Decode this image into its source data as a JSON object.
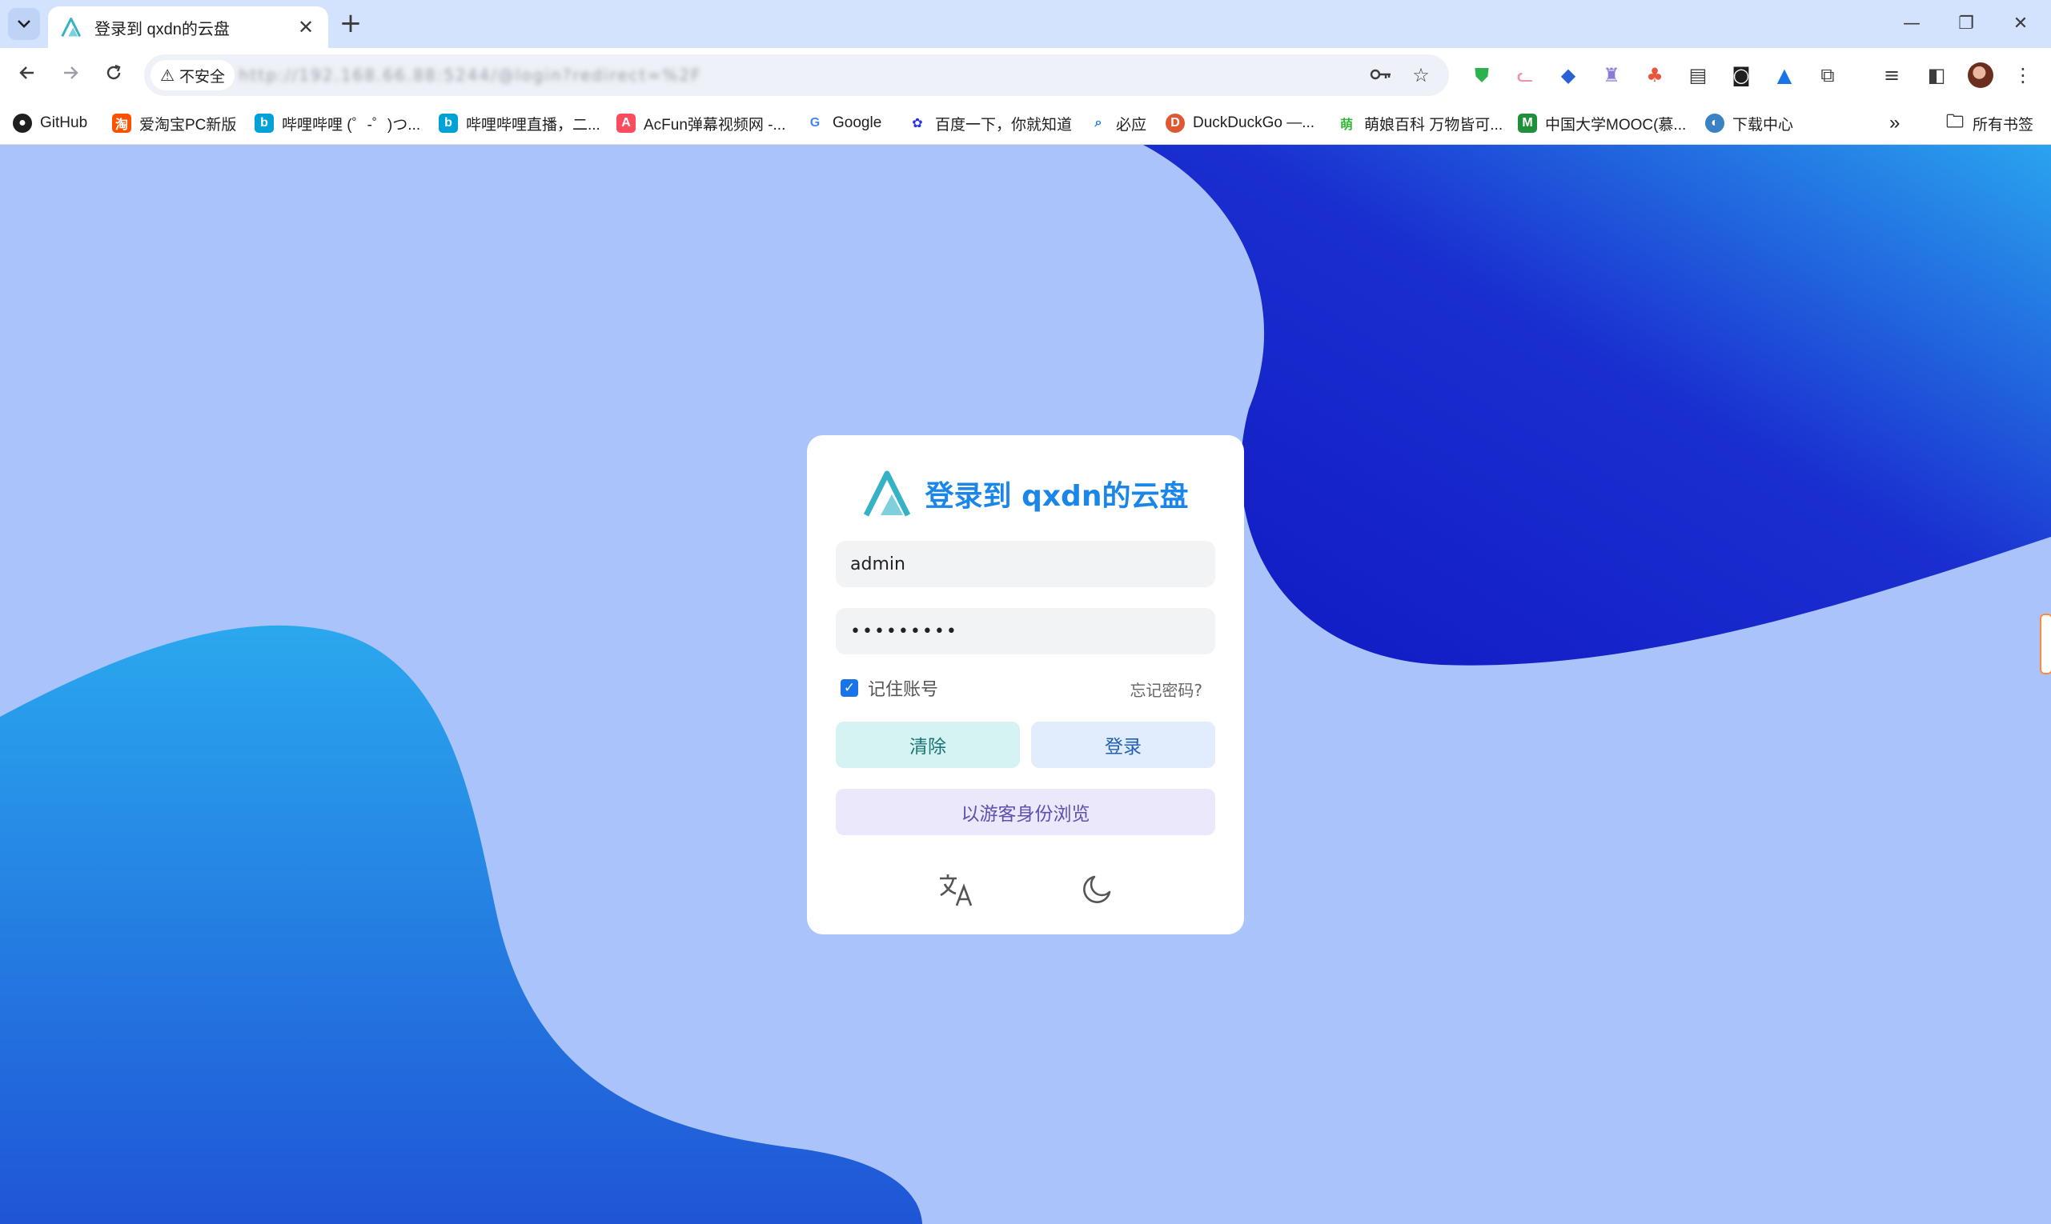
{
  "browser": {
    "tab": {
      "title": "登录到 qxdn的云盘",
      "close": "✕"
    },
    "new_tab": "+",
    "window_controls": {
      "minimize": "—",
      "restore": "❐",
      "close": "✕"
    },
    "security_chip": "不安全",
    "url_obscured": "http://192.168.66.88:5244/@login?redirect=%2F",
    "bookmarks": [
      {
        "label": "GitHub",
        "icon": "github-icon",
        "color": "#1f1f1f"
      },
      {
        "label": "爱淘宝PC新版",
        "icon": "taobao-icon",
        "color": "#ff5000"
      },
      {
        "label": "哔哩哔哩 (゜-゜)つ...",
        "icon": "bilibili-icon",
        "color": "#00a1d6"
      },
      {
        "label": "哔哩哔哩直播，二...",
        "icon": "bilibili-live-icon",
        "color": "#00a1d6"
      },
      {
        "label": "AcFun弹幕视频网 -...",
        "icon": "acfun-icon",
        "color": "#fd4c5d"
      },
      {
        "label": "Google",
        "icon": "google-icon",
        "color": "#4285f4"
      },
      {
        "label": "百度一下，你就知道",
        "icon": "baidu-icon",
        "color": "#2932e1"
      },
      {
        "label": "必应",
        "icon": "bing-search-icon",
        "color": "#1a73e8"
      },
      {
        "label": "DuckDuckGo —...",
        "icon": "duckduckgo-icon",
        "color": "#de5833"
      },
      {
        "label": "萌娘百科 万物皆可...",
        "icon": "moegirl-icon",
        "color": "#35b538"
      },
      {
        "label": "中国大学MOOC(慕...",
        "icon": "mooc-icon",
        "color": "#1f8f3a"
      },
      {
        "label": "下载中心",
        "icon": "download-center-icon",
        "color": "#3b82c4"
      }
    ],
    "all_bookmarks": "所有书签",
    "bookmarks_overflow": "»"
  },
  "login": {
    "title": "登录到 qxdn的云盘",
    "username_value": "admin",
    "password_value": "•••••••••",
    "remember_label": "记住账号",
    "remember_checked": true,
    "forgot_label": "忘记密码?",
    "clear_label": "清除",
    "login_label": "登录",
    "guest_label": "以游客身份浏览"
  },
  "colors": {
    "page_bg": "#aac4fb",
    "title_accent": "#1a86ea",
    "blob_dark": "#1521c7",
    "blob_light": "#29a8ee"
  }
}
